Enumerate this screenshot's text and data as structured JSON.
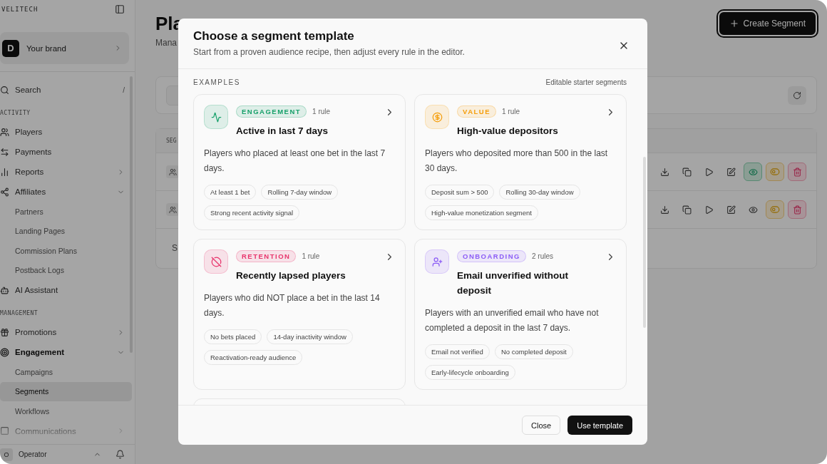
{
  "sidebar": {
    "brand": "VELITECH",
    "workspace": {
      "initial": "D",
      "name": "Your brand"
    },
    "search": {
      "label": "Search",
      "shortcut": "/"
    },
    "sections": [
      {
        "heading": "ACTIVITY",
        "items": [
          {
            "label": "Players",
            "selected": false
          },
          {
            "label": "Payments",
            "selected": false
          },
          {
            "label": "Reports",
            "selected": false,
            "expanded": false
          },
          {
            "label": "Affiliates",
            "selected": false,
            "expanded": true,
            "children": [
              {
                "label": "Partners",
                "selected": false
              },
              {
                "label": "Landing Pages",
                "selected": false
              },
              {
                "label": "Commission Plans",
                "selected": false
              },
              {
                "label": "Postback Logs",
                "selected": false
              }
            ]
          },
          {
            "label": "AI Assistant",
            "selected": false
          }
        ]
      },
      {
        "heading": "MANAGEMENT",
        "items": [
          {
            "label": "Promotions",
            "selected": false,
            "expanded": false
          },
          {
            "label": "Engagement",
            "selected": true,
            "expanded": true,
            "children": [
              {
                "label": "Campaigns",
                "selected": false
              },
              {
                "label": "Segments",
                "selected": true
              },
              {
                "label": "Workflows",
                "selected": false
              }
            ]
          },
          {
            "label": "Communications",
            "selected": false,
            "expanded": false
          }
        ]
      }
    ],
    "user": {
      "initial": "O",
      "name": "Operator"
    }
  },
  "page": {
    "title": "Pla",
    "subtitle": "Mana",
    "create_button": "Create Segment",
    "table": {
      "header": "SEG",
      "rows": [
        {
          "visible": true
        },
        {
          "visible": false
        }
      ],
      "footer": "S"
    }
  },
  "modal": {
    "title": "Choose a segment template",
    "subtitle": "Start from a proven audience recipe, then adjust every rule in the editor.",
    "section_label": "EXAMPLES",
    "section_note": "Editable starter segments",
    "templates": [
      {
        "kind": "engagement",
        "badge": "ENGAGEMENT",
        "color": "#16a06a",
        "rules": "1 rule",
        "title": "Active in last 7 days",
        "description": "Players who placed at least one bet in the last 7 days.",
        "tags": [
          "At least 1 bet",
          "Rolling 7-day window",
          "Strong recent activity signal"
        ]
      },
      {
        "kind": "value",
        "badge": "VALUE",
        "color": "#f59e0b",
        "rules": "1 rule",
        "title": "High-value depositors",
        "description": "Players who deposited more than 500 in the last 30 days.",
        "tags": [
          "Deposit sum > 500",
          "Rolling 30-day window",
          "High-value monetization segment"
        ]
      },
      {
        "kind": "retention",
        "badge": "RETENTION",
        "color": "#e8336b",
        "rules": "1 rule",
        "title": "Recently lapsed players",
        "description": "Players who did NOT place a bet in the last 14 days.",
        "tags": [
          "No bets placed",
          "14-day inactivity window",
          "Reactivation-ready audience"
        ]
      },
      {
        "kind": "onboarding",
        "badge": "ONBOARDING",
        "color": "#8b5cf6",
        "rules": "2 rules",
        "title": "Email unverified without deposit",
        "description": "Players with an unverified email who have not completed a deposit in the last 7 days.",
        "tags": [
          "Email not verified",
          "No completed deposit",
          "Early-lifecycle onboarding"
        ]
      }
    ],
    "buttons": {
      "secondary": "Close",
      "primary": "Use template"
    }
  }
}
